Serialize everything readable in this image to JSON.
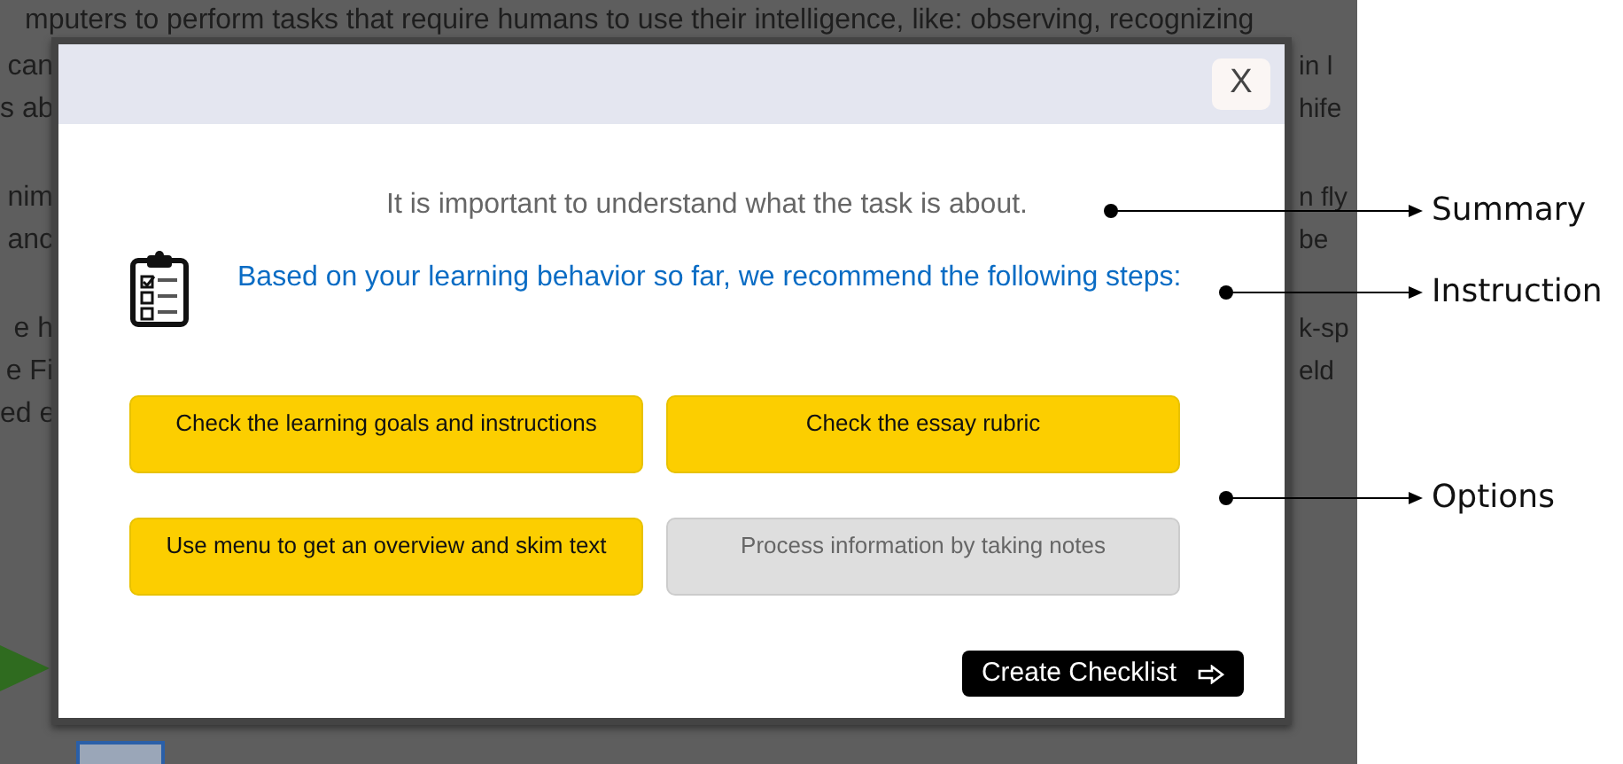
{
  "background_page": {
    "top_line": "mputers to perform tasks that require humans to use their intelligence, like: observing, recognizing",
    "paragraphs": [
      [
        {
          "left": "can",
          "right": "in l"
        },
        {
          "left": "s ab",
          "right": "hife"
        }
      ],
      [
        {
          "left": "nim",
          "right": "n fly"
        },
        {
          "left": "anc",
          "right": "be"
        }
      ],
      [
        {
          "left": "e h",
          "right": "k-sp"
        },
        {
          "left": "e Fi",
          "right": "eld"
        },
        {
          "left": "ed e"
        }
      ]
    ]
  },
  "dialog": {
    "close_label": "X",
    "summary": "It is important to understand what the task is about.",
    "instruction": "Based on your learning behavior so far, we recommend the following steps:",
    "options": [
      {
        "label": "Check the learning goals and instructions",
        "selected": true
      },
      {
        "label": "Check the essay rubric",
        "selected": true
      },
      {
        "label": "Use menu to get an overview and skim text",
        "selected": true
      },
      {
        "label": "Process information by taking notes",
        "selected": false
      }
    ],
    "primary_button": "Create Checklist"
  },
  "annotations": [
    {
      "label": "Summary"
    },
    {
      "label": "Instruction"
    },
    {
      "label": "Options"
    }
  ]
}
